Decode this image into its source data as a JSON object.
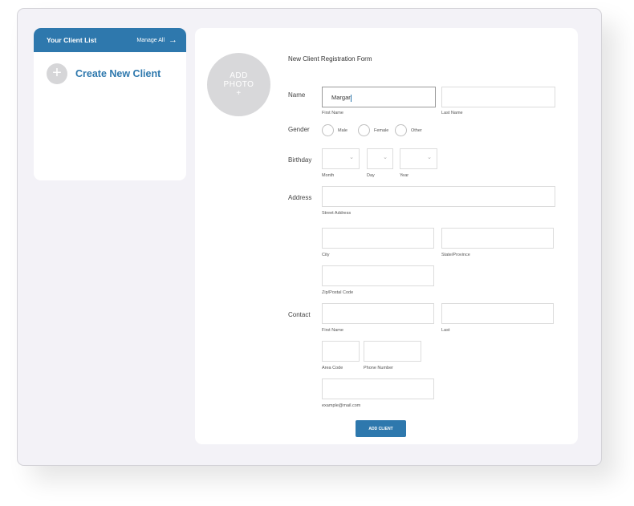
{
  "sidebar": {
    "title": "Your Client List",
    "manage_label": "Manage All",
    "manage_icon": "arrow-right-icon",
    "create_label": "Create New Client",
    "create_icon": "plus-icon"
  },
  "photo": {
    "line1": "ADD",
    "line2": "PHOTO",
    "line3": "+"
  },
  "form": {
    "title": "New Client Registration Form",
    "name": {
      "label": "Name",
      "first_value": "Margar",
      "first_sub": "First Name",
      "last_sub": "Last Name"
    },
    "gender": {
      "label": "Gender",
      "options": [
        "Male",
        "Female",
        "Other"
      ]
    },
    "birthday": {
      "label": "Birthday",
      "month_sub": "Month",
      "day_sub": "Day",
      "year_sub": "Year",
      "chevron": "chevron-down-icon"
    },
    "address": {
      "label": "Address",
      "street_sub": "Street Address",
      "city_sub": "City",
      "state_sub": "State/Province",
      "zip_sub": "Zip/Postal Code"
    },
    "contact": {
      "label": "Contact",
      "first_sub": "First Name",
      "last_sub": "Last",
      "area_sub": "Area Code",
      "phone_sub": "Phone Number",
      "email_sub": "example@mail.com"
    },
    "submit_label": "ADD CLIENT"
  },
  "colors": {
    "accent": "#2e78ad",
    "frame_bg": "#f3f2f7",
    "photo_bg": "#d8d8da"
  }
}
